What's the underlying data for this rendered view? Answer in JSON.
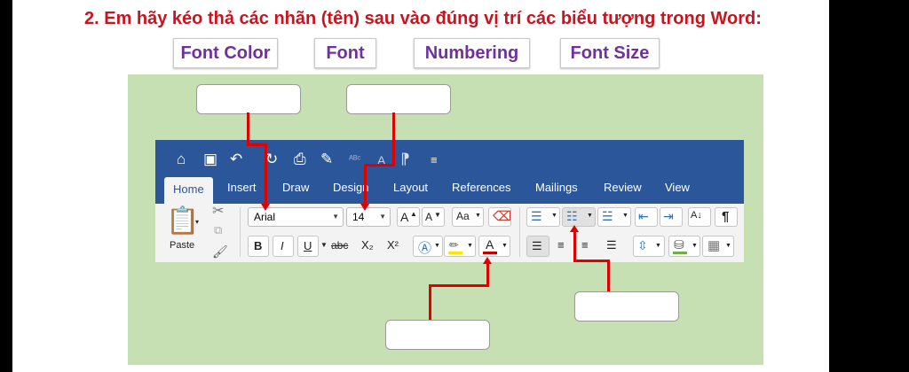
{
  "question": "2. Em hãy kéo thả các nhãn (tên) sau vào đúng vị trí các biểu tượng trong Word:",
  "labels": [
    "Font Color",
    "Font",
    "Numbering",
    "Font Size"
  ],
  "word": {
    "tabs": [
      "Home",
      "Insert",
      "Draw",
      "Design",
      "Layout",
      "References",
      "Mailings",
      "Review",
      "View"
    ],
    "font_name": "Arial",
    "font_size": "14",
    "paste_label": "Paste",
    "bold": "B",
    "italic": "I",
    "underline": "U",
    "strike": "abc",
    "subscript": "X₂",
    "superscript": "X²",
    "font_color_letter": "A",
    "grow": "A",
    "shrink": "A",
    "change_case": "Aa",
    "sort": "A↓",
    "pilcrow": "¶"
  },
  "colors": {
    "title_red": "#c8141e",
    "label_purple": "#7030a0",
    "word_blue": "#2b579a",
    "green_bg": "#c6e0b4",
    "arrow_red": "#e00000"
  }
}
